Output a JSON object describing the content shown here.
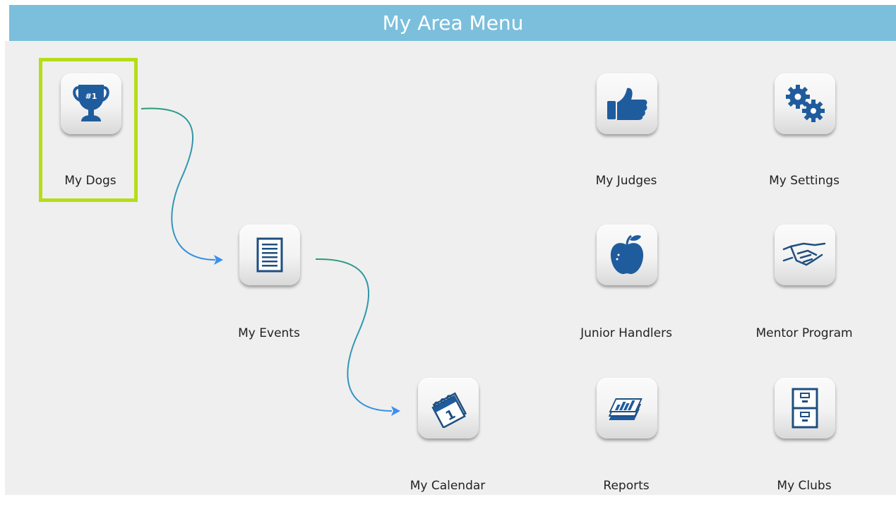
{
  "header": {
    "title": "My Area Menu"
  },
  "menu": {
    "my_dogs": {
      "label": "My Dogs",
      "icon": "trophy-icon"
    },
    "my_events": {
      "label": "My Events",
      "icon": "document-icon"
    },
    "my_calendar": {
      "label": "My Calendar",
      "icon": "calendar-icon"
    },
    "my_judges": {
      "label": "My Judges",
      "icon": "thumbs-up-icon"
    },
    "junior_handlers": {
      "label": "Junior Handlers",
      "icon": "apple-icon"
    },
    "reports": {
      "label": "Reports",
      "icon": "reports-icon"
    },
    "my_settings": {
      "label": "My Settings",
      "icon": "gears-icon"
    },
    "mentor_program": {
      "label": "Mentor Program",
      "icon": "handshake-icon"
    },
    "my_clubs": {
      "label": "My Clubs",
      "icon": "file-cabinet-icon"
    }
  },
  "trophy_badge": "#1",
  "calendar_day": "1",
  "colors": {
    "header": "#7bbfdc",
    "panel": "#efefef",
    "icon_blue": "#1f5c9e",
    "highlight": "#b5dd18",
    "arrow_start": "#2a9d6e",
    "arrow_end": "#3a8ff0"
  }
}
